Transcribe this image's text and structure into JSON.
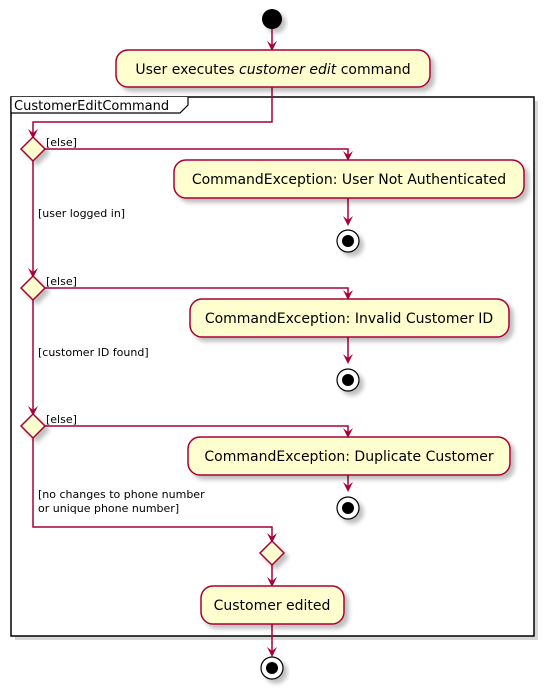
{
  "diagram": {
    "type": "UML activity diagram",
    "colors": {
      "flow": "#A80036",
      "activity_fill": "#FEFECE",
      "activity_border": "#A80036",
      "frame_border": "#000000",
      "shadow": "#d8d8d8",
      "node_fill": "#000000"
    },
    "start_activity": {
      "prefix": "User executes ",
      "emphasis": "customer edit",
      "suffix": " command"
    },
    "frame": {
      "title": "CustomerEditCommand"
    },
    "decisions": [
      {
        "else_label": "[else]",
        "else_activity": "CommandException: User Not Authenticated",
        "continue_label": [
          "[user logged in]"
        ]
      },
      {
        "else_label": "[else]",
        "else_activity": "CommandException: Invalid Customer ID",
        "continue_label": [
          "[customer ID found]"
        ]
      },
      {
        "else_label": "[else]",
        "else_activity": "CommandException: Duplicate Customer",
        "continue_label": [
          "[no changes to phone number",
          "or unique phone number]"
        ]
      }
    ],
    "final_activity": "Customer edited"
  }
}
